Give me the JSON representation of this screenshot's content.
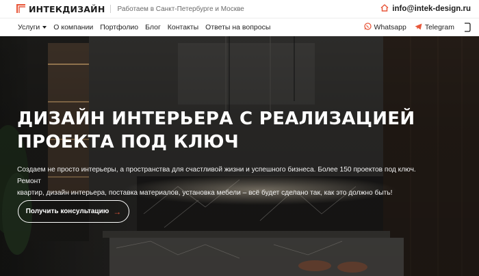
{
  "header": {
    "logo_text": "ИНТЕКДИЗАЙН",
    "region": "Работаем в Санкт-Петербурге и Москве",
    "email": "info@intek-design.ru"
  },
  "nav": {
    "items": [
      "Услуги",
      "О компании",
      "Портфолио",
      "Блог",
      "Контакты",
      "Ответы на вопросы"
    ],
    "messengers": [
      "Whatsapp",
      "Telegram"
    ]
  },
  "hero": {
    "title_line1": "ДИЗАЙН ИНТЕРЬЕРА С РЕАЛИЗАЦИЕЙ",
    "title_line2": "ПРОЕКТА ПОД КЛЮЧ",
    "text_line1": "Создаем не просто интерьеры, а пространства для счастливой жизни и успешного бизнеса. Более 150 проектов под ключ. Ремонт",
    "text_line2": "квартир, дизайн интерьера, поставка материалов, установка мебели – всё будет сделано так, как это должно быть!",
    "cta_label": "Получить консультацию",
    "cta_arrow": "→"
  },
  "colors": {
    "accent": "#e8573a",
    "text_dark": "#1e1e1e",
    "muted": "#6b6b6b",
    "hero_text": "#ffffff"
  },
  "icons": [
    "logo-mark-icon",
    "home-icon",
    "whatsapp-icon",
    "telegram-icon",
    "phone-icon",
    "arrow-right-icon"
  ]
}
